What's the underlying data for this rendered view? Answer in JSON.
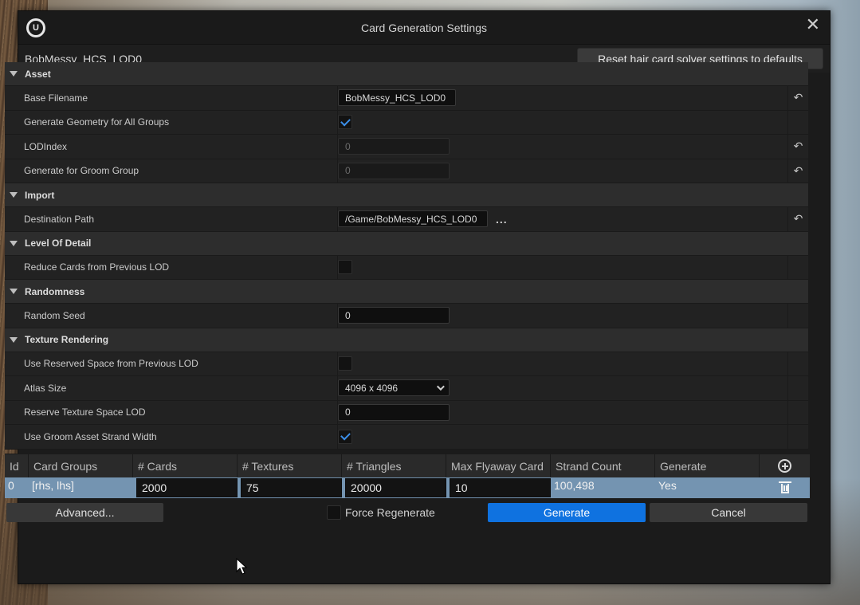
{
  "window": {
    "title": "Card Generation Settings",
    "asset_name": "BobMessy_HCS_LOD0",
    "reset_button": "Reset hair card solver settings to defaults"
  },
  "sections": {
    "asset": {
      "title": "Asset",
      "base_filename_label": "Base Filename",
      "base_filename_value": "BobMessy_HCS_LOD0",
      "generate_geometry_label": "Generate Geometry for All Groups",
      "generate_geometry_checked": true,
      "lod_index_label": "LODIndex",
      "lod_index_value": "0",
      "groom_group_label": "Generate for Groom Group",
      "groom_group_value": "0"
    },
    "import": {
      "title": "Import",
      "destination_label": "Destination Path",
      "destination_value": "/Game/BobMessy_HCS_LOD0",
      "browse": "..."
    },
    "lod": {
      "title": "Level Of Detail",
      "reduce_cards_label": "Reduce Cards from Previous LOD",
      "reduce_cards_checked": false
    },
    "randomness": {
      "title": "Randomness",
      "seed_label": "Random Seed",
      "seed_value": "0"
    },
    "texture": {
      "title": "Texture Rendering",
      "reserved_space_label": "Use Reserved Space from Previous LOD",
      "reserved_space_checked": false,
      "atlas_label": "Atlas Size",
      "atlas_value": "4096 x 4096",
      "reserve_lod_label": "Reserve Texture Space LOD",
      "reserve_lod_value": "0",
      "strand_width_label": "Use Groom Asset Strand Width",
      "strand_width_checked": true
    }
  },
  "table": {
    "headers": [
      "Id",
      "Card Groups",
      "# Cards",
      "# Textures",
      "# Triangles",
      "Max Flyaway Card",
      "Strand Count",
      "Generate"
    ],
    "row": {
      "id": "0",
      "card_groups": "[rhs, lhs]",
      "cards": "2000",
      "textures": "75",
      "triangles": "20000",
      "max_flyaway": "10",
      "strand_count": "100,498",
      "generate": "Yes"
    }
  },
  "footer": {
    "advanced": "Advanced...",
    "force_regenerate": "Force Regenerate",
    "generate": "Generate",
    "cancel": "Cancel"
  }
}
